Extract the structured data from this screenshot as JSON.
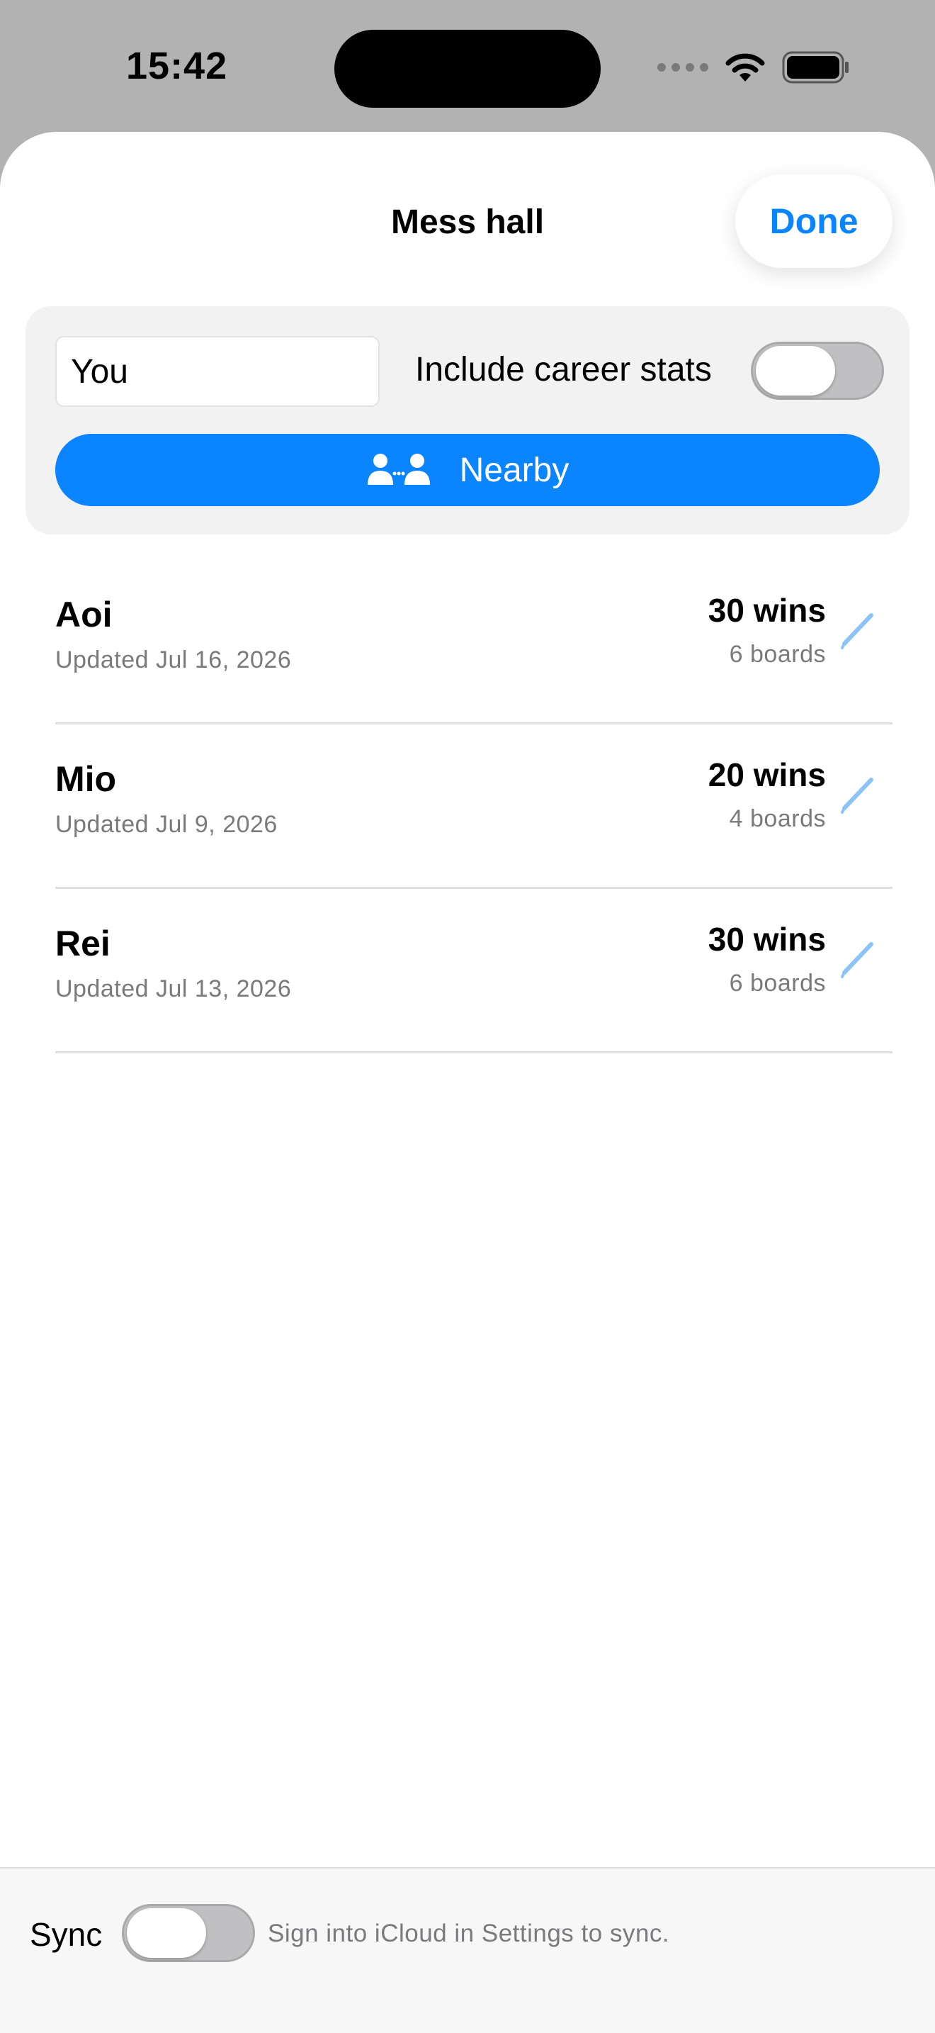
{
  "status_bar": {
    "time": "15:42"
  },
  "sheet": {
    "title": "Mess hall",
    "done_label": "Done"
  },
  "controls": {
    "name_value": "You",
    "career_label": "Include career stats",
    "career_enabled": false,
    "nearby_label": "Nearby",
    "nearby_icon": "people-nearby-icon"
  },
  "players": [
    {
      "name": "Aoi",
      "updated": "Updated Jul 16, 2026",
      "wins": "30 wins",
      "boards": "6 boards"
    },
    {
      "name": "Mio",
      "updated": "Updated Jul 9, 2026",
      "wins": "20 wins",
      "boards": "4 boards"
    },
    {
      "name": "Rei",
      "updated": "Updated Jul 13, 2026",
      "wins": "30 wins",
      "boards": "6 boards"
    }
  ],
  "footer": {
    "sync_label": "Sync",
    "sync_enabled": false,
    "sync_note": "Sign into iCloud in Settings to sync."
  },
  "colors": {
    "accent": "#0a84ff",
    "edit_icon": "#8cc4f5",
    "secondary_text": "#7a7a7e"
  }
}
